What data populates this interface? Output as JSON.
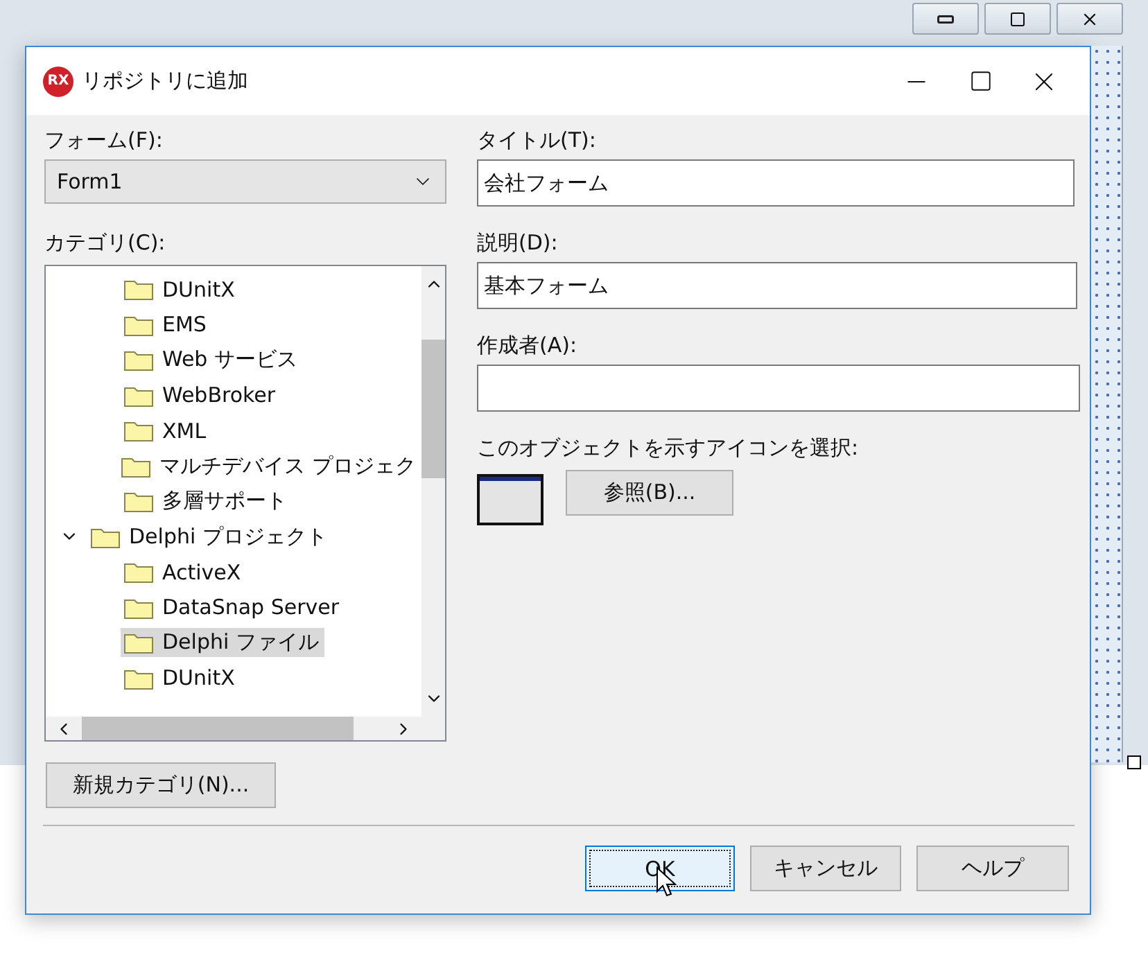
{
  "dialog": {
    "logo_text": "RX",
    "title": "リポジトリに追加"
  },
  "form_field": {
    "label": "フォーム(F):",
    "value": "Form1"
  },
  "category": {
    "label": "カテゴリ(C):",
    "items": [
      {
        "children": [
          {
            "label": "DUnitX",
            "selected": false
          },
          {
            "label": "EMS",
            "selected": false
          },
          {
            "label": "Web サービス",
            "selected": false
          },
          {
            "label": "WebBroker",
            "selected": false
          },
          {
            "label": "XML",
            "selected": false
          },
          {
            "label": "マルチデバイス プロジェク",
            "selected": false
          },
          {
            "label": "多層サポート",
            "selected": false
          }
        ]
      },
      {
        "label": "Delphi プロジェクト",
        "selected": false,
        "expanded": true,
        "children": [
          {
            "label": "ActiveX",
            "selected": false
          },
          {
            "label": "DataSnap Server",
            "selected": false
          },
          {
            "label": "Delphi ファイル",
            "selected": true
          },
          {
            "label": "DUnitX",
            "selected": false
          }
        ]
      }
    ]
  },
  "new_category_button": "新規カテゴリ(N)...",
  "title_field": {
    "label": "タイトル(T):",
    "value": "会社フォーム"
  },
  "description_field": {
    "label": "説明(D):",
    "value": "基本フォーム"
  },
  "author_field": {
    "label": "作成者(A):"
  },
  "icon_select": {
    "label": "このオブジェクトを示すアイコンを選択:",
    "browse_button": "参照(B)..."
  },
  "buttons": [
    {
      "label": "OK",
      "default": true
    },
    {
      "label": "キャンセル",
      "default": false
    },
    {
      "label": "ヘルプ",
      "default": false
    }
  ]
}
